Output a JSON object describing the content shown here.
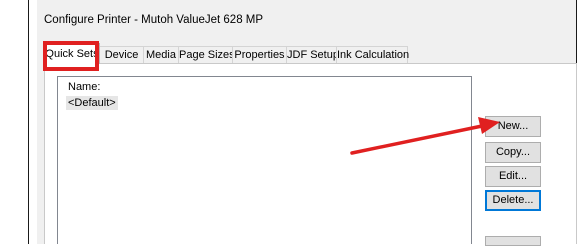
{
  "window": {
    "title": "Configure Printer - Mutoh ValueJet 628 MP"
  },
  "tabs": [
    {
      "label": "Quick Sets",
      "active": true
    },
    {
      "label": "Device",
      "active": false
    },
    {
      "label": "Media",
      "active": false
    },
    {
      "label": "Page Sizes",
      "active": false
    },
    {
      "label": "Properties",
      "active": false
    },
    {
      "label": "JDF Setup",
      "active": false
    },
    {
      "label": "Ink Calculation",
      "active": false
    }
  ],
  "list": {
    "label": "Name:",
    "items": [
      {
        "label": "<Default>",
        "selected": true
      }
    ]
  },
  "buttons": {
    "new": "New...",
    "copy": "Copy...",
    "edit": "Edit...",
    "delete": "Delete..."
  },
  "annotations": {
    "highlight_color": "#e02020"
  }
}
